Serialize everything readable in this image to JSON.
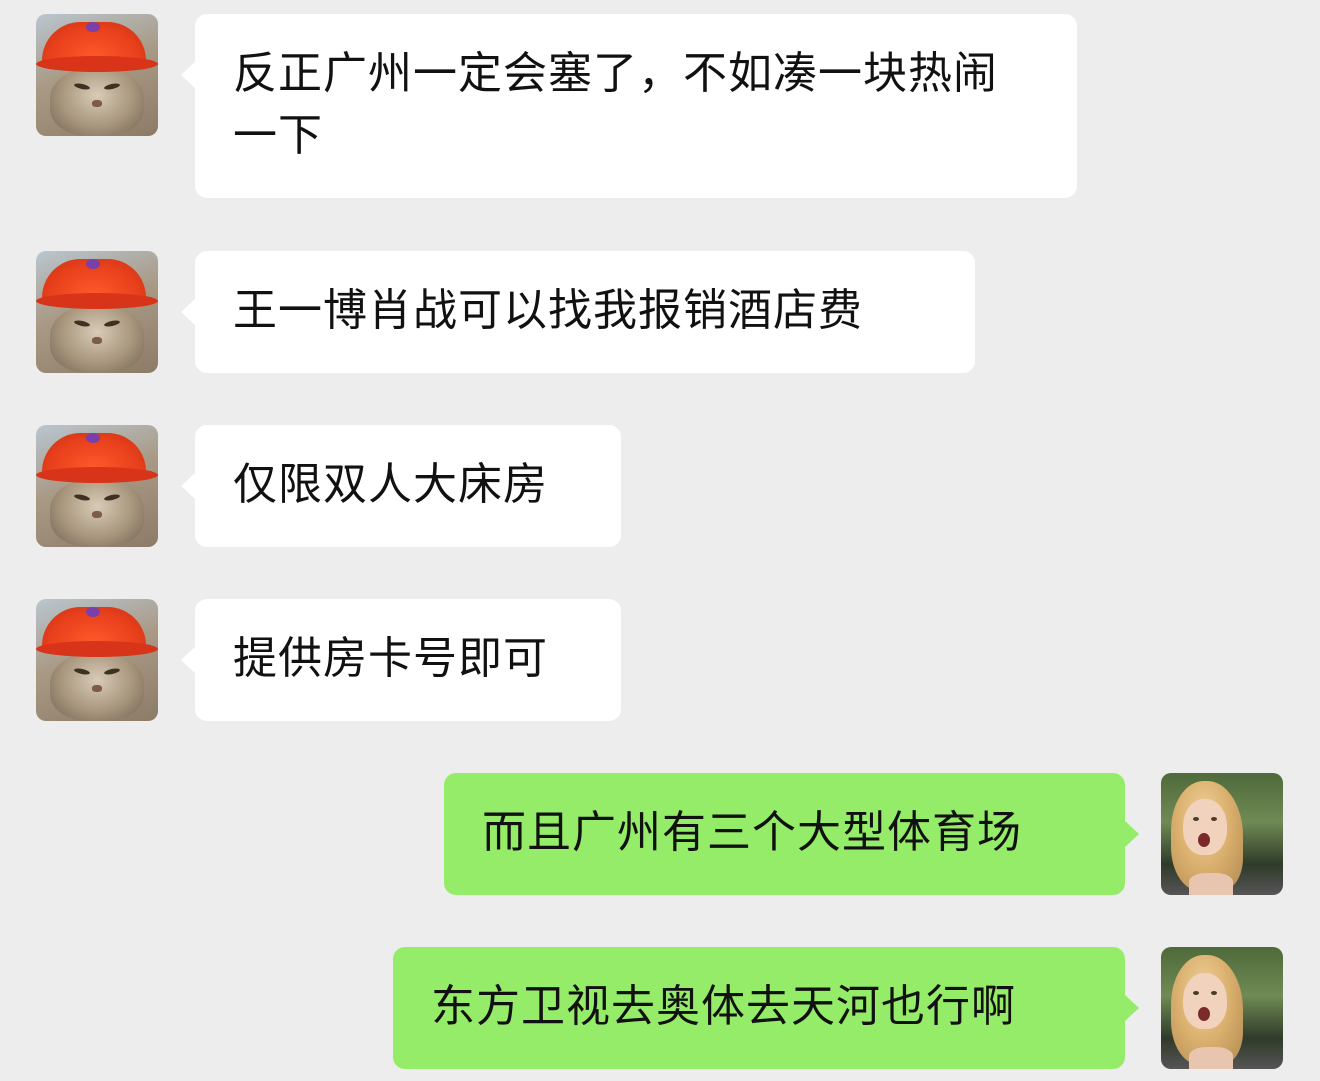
{
  "conversation": {
    "messages": [
      {
        "sender": "other",
        "avatar": "cat-red-cap-avatar",
        "text": "反正广州一定会塞了，不如凑一块热闹一下"
      },
      {
        "sender": "other",
        "avatar": "cat-red-cap-avatar",
        "text": "王一博肖战可以找我报销酒店费"
      },
      {
        "sender": "other",
        "avatar": "cat-red-cap-avatar",
        "text": "仅限双人大床房"
      },
      {
        "sender": "other",
        "avatar": "cat-red-cap-avatar",
        "text": "提供房卡号即可"
      },
      {
        "sender": "self",
        "avatar": "girl-blonde-avatar",
        "text": "而且广州有三个大型体育场"
      },
      {
        "sender": "self",
        "avatar": "girl-blonde-avatar",
        "text": "东方卫视去奥体去天河也行啊"
      }
    ]
  },
  "colors": {
    "background": "#ededed",
    "incoming_bubble": "#ffffff",
    "outgoing_bubble": "#95ec69",
    "text": "#111111"
  }
}
